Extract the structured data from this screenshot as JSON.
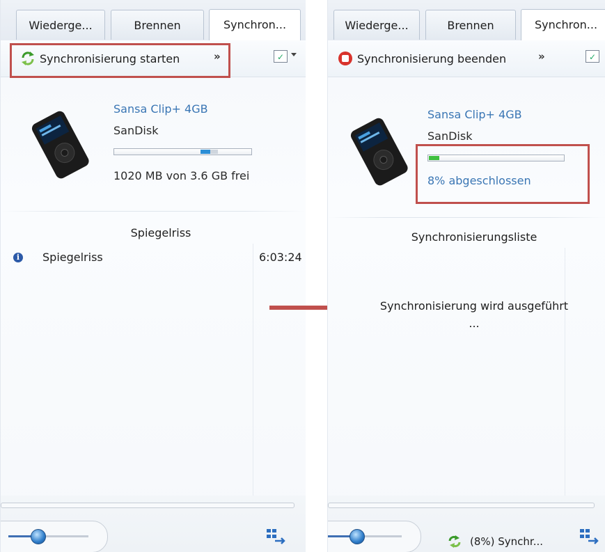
{
  "left": {
    "tabs": [
      "Wiederge...",
      "Brennen",
      "Synchron..."
    ],
    "toolbar": {
      "action_label": "Synchronisierung starten",
      "more": "»",
      "options_mark": "✓"
    },
    "device": {
      "name": "Sansa Clip+ 4GB",
      "brand": "SanDisk",
      "storage_text": "1020 MB von 3.6 GB frei"
    },
    "list": {
      "title": "Spiegelriss",
      "items": [
        {
          "name": "Spiegelriss",
          "duration": "6:03:24"
        }
      ]
    }
  },
  "right": {
    "tabs": [
      "Wiederge...",
      "Brennen",
      "Synchron..."
    ],
    "toolbar": {
      "action_label": "Synchronisierung beenden",
      "more": "»",
      "options_mark": "✓"
    },
    "device": {
      "name": "Sansa Clip+ 4GB",
      "brand": "SanDisk",
      "progress_text": "8% abgeschlossen",
      "progress_fraction": 0.08
    },
    "list": {
      "title": "Synchronisierungsliste",
      "busy_line1": "Synchronisierung wird ausgeführt",
      "busy_line2": "..."
    },
    "status": {
      "text": "(8%) Synchr..."
    }
  },
  "colors": {
    "highlight": "#c0504d",
    "link_blue": "#3a76b4",
    "progress_green": "#3fbf3f",
    "storage_blue": "#2c8ed6"
  },
  "icons": [
    "sync-arrows-icon",
    "stop-icon",
    "info-icon",
    "list-options-icon",
    "volume-knob-icon",
    "sync-list-icon",
    "device-image",
    "arrow-right"
  ]
}
